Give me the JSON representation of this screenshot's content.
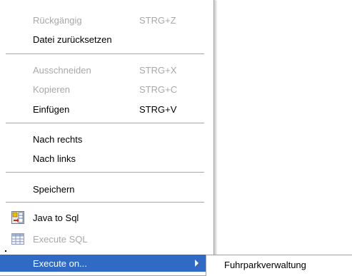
{
  "menu": {
    "undo": {
      "label": "Rückgängig",
      "shortcut": "STRG+Z"
    },
    "revert": {
      "label": "Datei zurücksetzen"
    },
    "cut": {
      "label": "Ausschneiden",
      "shortcut": "STRG+X"
    },
    "copy": {
      "label": "Kopieren",
      "shortcut": "STRG+C"
    },
    "paste": {
      "label": "Einfügen",
      "shortcut": "STRG+V"
    },
    "next": {
      "label": "Nach rechts"
    },
    "previous": {
      "label": "Nach links"
    },
    "save": {
      "label": "Speichern"
    },
    "java_to_sql": {
      "label": "Java to Sql",
      "icon": "java-to-sql-icon"
    },
    "execute_sql": {
      "label": "Execute SQL",
      "icon": "table-grid-icon"
    },
    "execute_on": {
      "label": "Execute on...",
      "icon": "submenu-arrow-icon"
    }
  },
  "submenu": {
    "item": {
      "label": "Fuhrparkverwaltung"
    }
  },
  "colors": {
    "highlight": "#316ac5",
    "disabled_text": "#a8a8a8",
    "separator": "#a8a8a8"
  }
}
